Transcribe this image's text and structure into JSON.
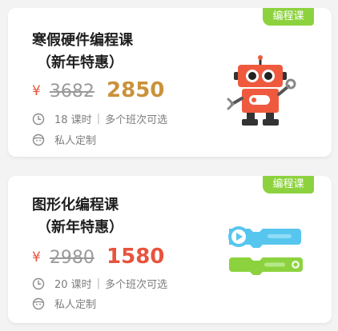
{
  "cards": [
    {
      "tag": "编程课",
      "title_line1": "寒假硬件编程课",
      "title_line2": "（新年特惠）",
      "currency": "¥",
      "old_price": "3682",
      "new_price": "2850",
      "lessons": "18 课时",
      "divider": "|",
      "schedule": "多个班次可选",
      "custom": "私人定制",
      "image_icon": "robot-icon"
    },
    {
      "tag": "编程课",
      "title_line1": "图形化编程课",
      "title_line2": "（新年特惠）",
      "currency": "¥",
      "old_price": "2980",
      "new_price": "1580",
      "lessons": "20 课时",
      "divider": "|",
      "schedule": "多个班次可选",
      "custom": "私人定制",
      "image_icon": "code-blocks-icon"
    }
  ],
  "colors": {
    "tag_green": "#8cd23e",
    "price_gold": "#c9923a",
    "price_red": "#e8533c",
    "robot_red": "#ef5a3e",
    "block_blue": "#56c6ef",
    "block_green": "#8cd23e"
  }
}
